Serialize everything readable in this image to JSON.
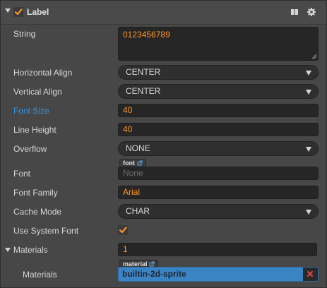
{
  "header": {
    "title": "Label",
    "enabled": true,
    "icons": [
      "book-icon",
      "gear-icon"
    ]
  },
  "fields": {
    "string": {
      "label": "String",
      "value": "0123456789"
    },
    "horizontal_align": {
      "label": "Horizontal Align",
      "value": "CENTER"
    },
    "vertical_align": {
      "label": "Vertical Align",
      "value": "CENTER"
    },
    "font_size": {
      "label": "Font Size",
      "value": "40"
    },
    "line_height": {
      "label": "Line Height",
      "value": "40"
    },
    "overflow": {
      "label": "Overflow",
      "value": "NONE"
    },
    "font": {
      "label": "Font",
      "tag": "font",
      "placeholder": "None"
    },
    "font_family": {
      "label": "Font Family",
      "value": "Arial"
    },
    "cache_mode": {
      "label": "Cache Mode",
      "value": "CHAR"
    },
    "use_system_font": {
      "label": "Use System Font",
      "checked": true
    },
    "materials_count": {
      "label": "Materials",
      "value": "1"
    },
    "material_item": {
      "label": "Materials",
      "tag": "material",
      "value": "builtin-2d-sprite"
    }
  },
  "colors": {
    "accent_orange": "#fd942b",
    "active_blue": "#2d95e6",
    "selection_blue": "#3b84c4",
    "remove_red": "#e24b4b"
  }
}
